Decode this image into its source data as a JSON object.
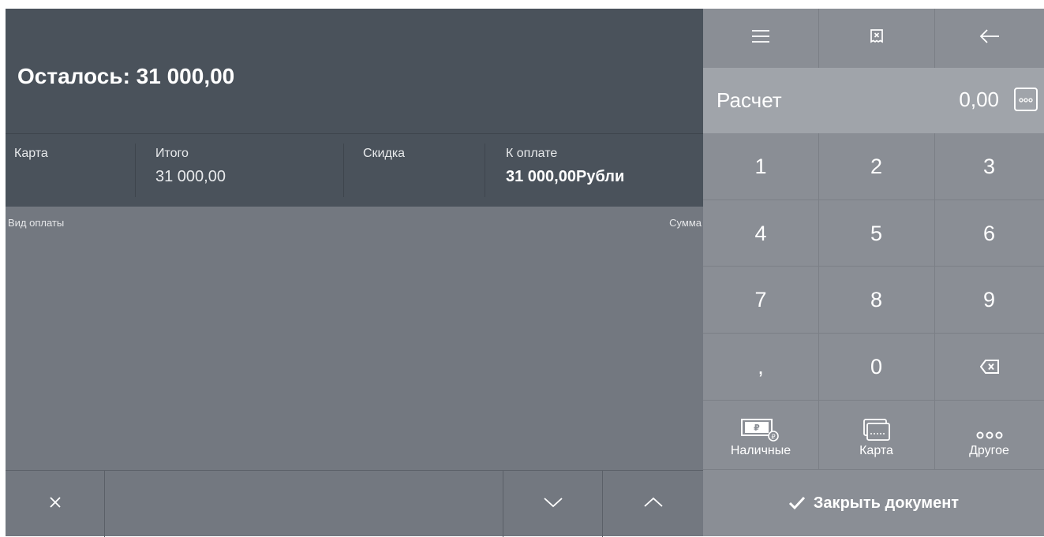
{
  "header": {
    "remaining": "Осталось: 31 000,00"
  },
  "summary": {
    "payment_type": "Карта",
    "total_label": "Итого",
    "total_value": "31 000,00",
    "discount_label": "Скидка",
    "due_label": "К оплате",
    "due_value": "31 000,00Рубли"
  },
  "list": {
    "col_type": "Вид оплаты",
    "col_sum": "Сумма",
    "rows": []
  },
  "calc": {
    "label": "Расчет",
    "value": "0,00"
  },
  "keypad": {
    "k1": "1",
    "k2": "2",
    "k3": "3",
    "k4": "4",
    "k5": "5",
    "k6": "6",
    "k7": "7",
    "k8": "8",
    "k9": "9",
    "comma": ",",
    "k0": "0"
  },
  "payments": {
    "cash": "Наличные",
    "card": "Карта",
    "other": "Другое"
  },
  "actions": {
    "close_document": "Закрыть документ"
  },
  "icons": {
    "menu": "menu-icon",
    "receipt": "receipt-cancel-icon",
    "back": "arrow-left-icon",
    "more": "more-icon",
    "backspace": "backspace-icon",
    "close": "close-icon",
    "down": "chevron-down-icon",
    "up": "chevron-up-icon",
    "check": "checkmark-icon"
  },
  "colors": {
    "dark_panel": "#4a525b",
    "list_bg": "#737880",
    "keypad_bg": "#8a8e95",
    "calc_bg": "#a0a4aa"
  }
}
